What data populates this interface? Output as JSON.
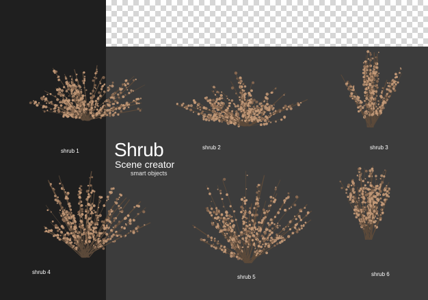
{
  "title": "Shrub",
  "subtitle": "Scene creator",
  "tagline": "smart objects",
  "colors": {
    "dark_panel": "#1f1f1f",
    "grey_panel": "#3c3c3c",
    "branch": "#5c4a3a",
    "flower": "#c49a78",
    "text": "#ffffff"
  },
  "shrubs": [
    {
      "label": "shrub 1",
      "form": "wide"
    },
    {
      "label": "shrub 2",
      "form": "wide"
    },
    {
      "label": "shrub 3",
      "form": "upright"
    },
    {
      "label": "shrub 4",
      "form": "round"
    },
    {
      "label": "shrub 5",
      "form": "round"
    },
    {
      "label": "shrub 6",
      "form": "upright"
    }
  ]
}
